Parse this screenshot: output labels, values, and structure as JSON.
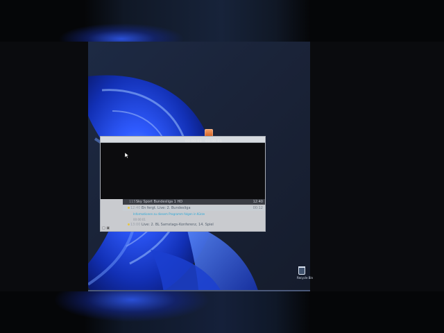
{
  "player": {
    "time_elapsed": "00:00:01",
    "time_total": "00:00:01"
  },
  "epg": {
    "channel_number": "115",
    "channel_name": "Sky Sport Bundesliga 1 HD",
    "header_time": "12:40",
    "rows": [
      {
        "start": "12:40",
        "title": "En fergt. Live: 2. Bundesliga",
        "end": "00:12",
        "subtitle": "Informationen zu diesem Programm folgen in Kürze",
        "subtitle2": "00:00:01"
      },
      {
        "start": "13:00",
        "title": "Live: 2. BL Samstags-Konferenz, 14. Spiel",
        "end": ""
      }
    ]
  },
  "desktop": {
    "recycle_bin_label": "Recycle Bin"
  },
  "colors": {
    "accent_blue": "#2f5bff",
    "osd_dark": "#3a3d44",
    "link_cyan": "#2aa8d8",
    "star_yellow": "#e7c640"
  },
  "icons": {
    "app": "media-player-icon",
    "cursor": "mouse-cursor-icon",
    "trash": "recycle-bin-icon"
  }
}
